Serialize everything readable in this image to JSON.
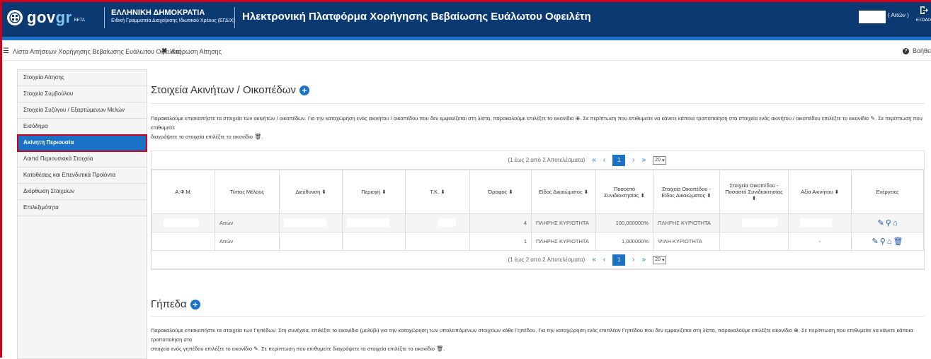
{
  "header": {
    "logo_main": "gov",
    "logo_accent": "gr",
    "logo_beta": "BETA",
    "org_title": "ΕΛΛΗΝΙΚΗ ΔΗΜΟΚΡΑΤΙΑ",
    "org_subtitle": "Ειδική Γραμματεία Διαχείρισης Ιδιωτικού Χρέους (ΕΓΔΙΧ)",
    "app_title": "Ηλεκτρονική Πλατφόρμα Χορήγησης Βεβαίωσης Ευάλωτου Οφειλέτη",
    "user_role": "( Αιτών )",
    "logout_label": "ΕΞΟΔΟΣ"
  },
  "toolbar": {
    "list_link": "Λίστα Αιτήσεων Χορήγησης Βεβαίωσης Ευάλωτου Οφειλέτη",
    "cancel_link": "Ακύρωση Αίτησης",
    "help_link": "Βοήθεια"
  },
  "sidebar": {
    "items": [
      {
        "label": "Στοιχεία Αίτησης"
      },
      {
        "label": "Στοιχεία Συμβούλου"
      },
      {
        "label": "Στοιχεία Συζύγου / Εξαρτώμενων Μελών"
      },
      {
        "label": "Εισόδημα"
      },
      {
        "label": "Ακίνητη Περιουσία"
      },
      {
        "label": "Λοιπά Περιουσιακά Στοιχεία"
      },
      {
        "label": "Καταθέσεις και Επενδυτικά Προϊόντα"
      },
      {
        "label": "Διόρθωση Στοιχείων"
      },
      {
        "label": "Επιλεξιμότητα"
      }
    ]
  },
  "properties": {
    "title": "Στοιχεία Ακινήτων / Οικοπέδων",
    "instructions_1": "Παρακαλούμε επισκοπήστε τα στοιχεία των ακινήτων / οικοπέδων. Για την καταχώρηση ενός ακινήτου / οικοπέδου που δεν εμφανίζεται στη λίστα, παρακαλούμε επιλέξτε το εικονίδιο",
    "instructions_2": ". Σε περίπτωση που επιθυμείτε να κάνετε κάποια τροποποίηση στα στοιχεία ενός ακινήτου / οικοπέδου επιλέξτε το εικονίδιο",
    "instructions_3": ". Σε περίπτωση που επιθυμείτε",
    "instructions_4": "διαγράψετε τα στοιχεία επιλέξτε το εικονίδιο",
    "pager_text": "(1 έως 2 από 2 Αποτελέσματα)",
    "pager_first": "«",
    "pager_prev": "‹",
    "pager_page": "1",
    "pager_next": "›",
    "pager_last": "»",
    "pager_size": "20",
    "columns": [
      "Α.Φ.Μ.",
      "Τύπος Μέλους",
      "Διεύθυνση ⬍",
      "Περιοχή ⬍",
      "Τ.Κ. ⬍",
      "Όροφος ⬍",
      "Είδος Δικαιώματος ⬍",
      "Ποσοστό Συνιδιοκτησίας ⬍",
      "Στοιχεία Οικοπέδου - Είδος Δικαιώματος ⬍",
      "Στοιχεία Οικοπέδου - Ποσοστό Συνιδιοκτησίας ⬍",
      "Αξία Ακινήτου ⬍",
      "Ενέργειες"
    ],
    "rows": [
      {
        "member": "Αιτών",
        "floor": "4",
        "right": "ΠΛΗΡΗΣ ΚΥΡΙΟΤΗΤΑ",
        "share": "100,000000%",
        "plot_right": "ΠΛΗΡΗΣ ΚΥΡΙΟΤΗΤΑ",
        "value": ""
      },
      {
        "member": "Αιτών",
        "floor": "1",
        "right": "ΠΛΗΡΗΣ ΚΥΡΙΟΤΗΤΑ",
        "share": "1,000000%",
        "plot_right": "ΨΙΛΗ ΚΥΡΙΟΤΗΤΑ",
        "value": "-"
      }
    ]
  },
  "land": {
    "title": "Γήπεδα",
    "instructions_1": "Παρακαλούμε επισκοπήστε τα στοιχεία των Γηπέδων. Στη συνέχεια, επιλέξτε το εικονίδιο (μολύβι) για την καταχώρηση των υπολειπόμενων στοιχείων κάθε Γηπέδου. Για την καταχώρηση ενός επιπλέον Γηπέδου που δεν εμφανίζεται στη λίστα, παρακαλούμε επιλέξτε εικονίδιο",
    "instructions_2": ". Σε περίπτωση που επιθυμείτε να κάνετε κάποια τροποποίηση στα",
    "instructions_3": "στοιχεία ενός γηπέδου επιλέξτε το εικονίδιο",
    "instructions_4": ". Σε περίπτωση που επιθυμείτε διαγράψετε τα στοιχεία επιλέξτε το εικονίδιο"
  }
}
